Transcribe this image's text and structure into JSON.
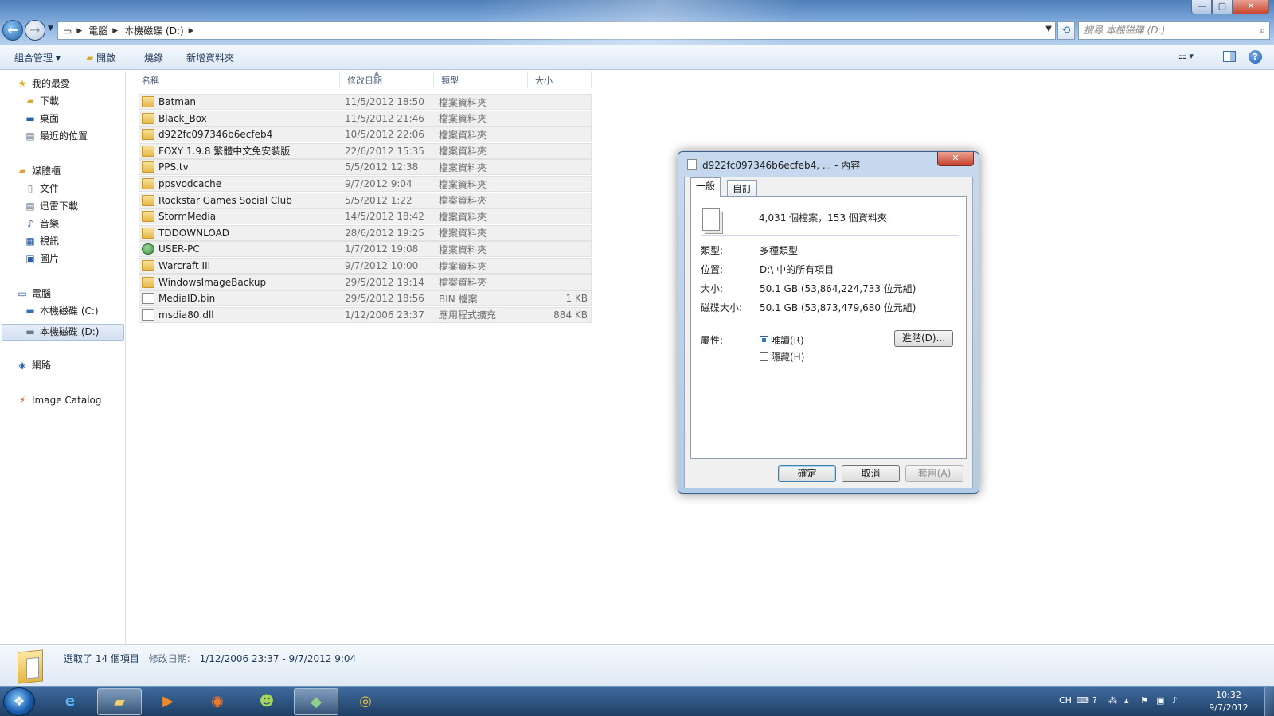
{
  "window": {
    "min": "—",
    "max": "▢",
    "close": "✕"
  },
  "address": {
    "crumbs": [
      "電腦",
      "本機磁碟 (D:)"
    ],
    "search_placeholder": "搜尋 本機磁碟 (D:)"
  },
  "toolbar": {
    "organize": "組合管理",
    "open": "開啟",
    "burn": "燒錄",
    "new_folder": "新增資料夾"
  },
  "nav": {
    "favorites": "我的最愛",
    "downloads": "下載",
    "desktop": "桌面",
    "recent": "最近的位置",
    "libraries": "媒體櫃",
    "documents": "文件",
    "thunder": "迅雷下載",
    "music": "音樂",
    "videos": "視訊",
    "pictures": "圖片",
    "computer": "電腦",
    "drive_c": "本機磁碟 (C:)",
    "drive_d": "本機磁碟 (D:)",
    "network": "網路",
    "image_catalog": "Image Catalog"
  },
  "columns": {
    "name": "名稱",
    "date": "修改日期",
    "type": "類型",
    "size": "大小"
  },
  "files": [
    {
      "name": "Batman",
      "date": "11/5/2012 18:50",
      "type": "檔案資料夾",
      "size": "",
      "icon": "folder"
    },
    {
      "name": "Black_Box",
      "date": "11/5/2012 21:46",
      "type": "檔案資料夾",
      "size": "",
      "icon": "folder"
    },
    {
      "name": "d922fc097346b6ecfeb4",
      "date": "10/5/2012 22:06",
      "type": "檔案資料夾",
      "size": "",
      "icon": "folder-lock"
    },
    {
      "name": "FOXY 1.9.8 繁體中文免安裝版",
      "date": "22/6/2012 15:35",
      "type": "檔案資料夾",
      "size": "",
      "icon": "folder"
    },
    {
      "name": "PPS.tv",
      "date": "5/5/2012 12:38",
      "type": "檔案資料夾",
      "size": "",
      "icon": "folder"
    },
    {
      "name": "ppsvodcache",
      "date": "9/7/2012 9:04",
      "type": "檔案資料夾",
      "size": "",
      "icon": "folder"
    },
    {
      "name": "Rockstar Games Social Club",
      "date": "5/5/2012 1:22",
      "type": "檔案資料夾",
      "size": "",
      "icon": "folder"
    },
    {
      "name": "StormMedia",
      "date": "14/5/2012 18:42",
      "type": "檔案資料夾",
      "size": "",
      "icon": "folder"
    },
    {
      "name": "TDDOWNLOAD",
      "date": "28/6/2012 19:25",
      "type": "檔案資料夾",
      "size": "",
      "icon": "folder"
    },
    {
      "name": "USER-PC",
      "date": "1/7/2012 19:08",
      "type": "檔案資料夾",
      "size": "",
      "icon": "network"
    },
    {
      "name": "Warcraft III",
      "date": "9/7/2012 10:00",
      "type": "檔案資料夾",
      "size": "",
      "icon": "folder"
    },
    {
      "name": "WindowsImageBackup",
      "date": "29/5/2012 19:14",
      "type": "檔案資料夾",
      "size": "",
      "icon": "folder"
    },
    {
      "name": "MediaID.bin",
      "date": "29/5/2012 18:56",
      "type": "BIN 檔案",
      "size": "1 KB",
      "icon": "file"
    },
    {
      "name": "msdia80.dll",
      "date": "1/12/2006 23:37",
      "type": "應用程式擴充",
      "size": "884 KB",
      "icon": "file"
    }
  ],
  "details": {
    "selected": "選取了 14 個項目",
    "date_label": "修改日期:",
    "date_range": "1/12/2006 23:37 - 9/7/2012 9:04"
  },
  "dialog": {
    "title": "d922fc097346b6ecfeb4, ... - 內容",
    "tab_general": "一般",
    "tab_custom": "自訂",
    "count": "4,031 個檔案，153 個資料夾",
    "type_label": "類型:",
    "type_value": "多種類型",
    "location_label": "位置:",
    "location_value": "D:\\ 中的所有項目",
    "size_label": "大小:",
    "size_value": "50.1 GB (53,864,224,733 位元組)",
    "disk_size_label": "磁碟大小:",
    "disk_size_value": "50.1 GB (53,873,479,680 位元組)",
    "attributes_label": "屬性:",
    "readonly": "唯讀(R)",
    "hidden": "隱藏(H)",
    "advanced": "進階(D)...",
    "ok": "確定",
    "cancel": "取消",
    "apply": "套用(A)"
  },
  "taskbar": {
    "lang": "CH",
    "time": "10:32",
    "date": "9/7/2012"
  }
}
